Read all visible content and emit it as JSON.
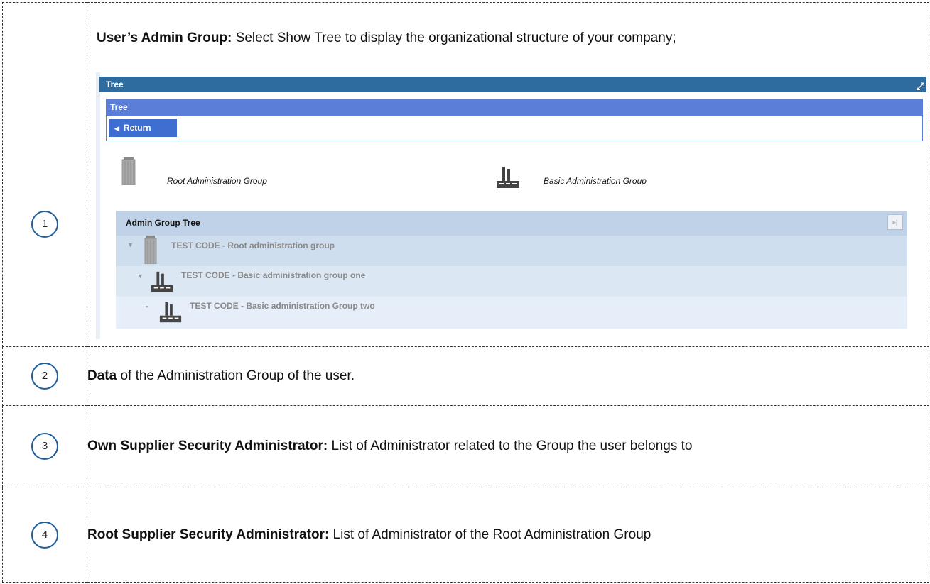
{
  "rows": [
    {
      "number": "1",
      "intro_bold": "User’s Admin Group:",
      "intro_text": " Select Show Tree to display the organizational structure of your company;"
    },
    {
      "number": "2",
      "bold": "Data",
      "text": " of the Administration Group of the user."
    },
    {
      "number": "3",
      "bold": "Own Supplier Security Administrator:",
      "text": " List of Administrator related to the Group the user belongs to"
    },
    {
      "number": "4",
      "bold": "Root Supplier Security Administrator:",
      "text": " List of Administrator of the Root Administration Group"
    }
  ],
  "screenshot": {
    "outer_title": "Tree",
    "inner_title": "Tree",
    "return_label": "Return",
    "legend": [
      {
        "label": "Root Administration Group",
        "icon": "building-icon"
      },
      {
        "label": "Basic Administration Group",
        "icon": "factory-icon"
      }
    ],
    "tree": {
      "header": "Admin Group Tree",
      "nodes": [
        {
          "label": "TEST CODE -  Root administration group",
          "icon": "building-icon",
          "level": 0
        },
        {
          "label": "TEST CODE - Basic administration group one",
          "icon": "factory-icon",
          "level": 1
        },
        {
          "label": "TEST CODE - Basic administration Group two",
          "icon": "factory-icon",
          "level": 2
        }
      ]
    }
  },
  "colors": {
    "circle_border": "#1f5e9c",
    "outer_titlebar": "#2e6b9e",
    "inner_titlebar": "#5b7fd8",
    "return_button": "#3e6fd0",
    "tree_header": "#bfd2e8"
  }
}
